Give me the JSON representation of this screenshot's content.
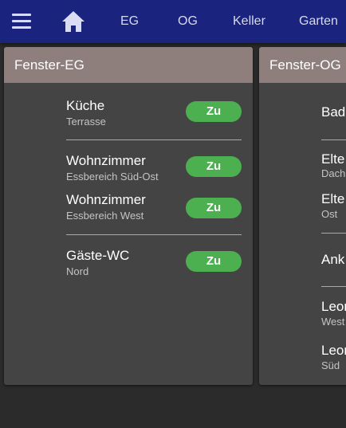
{
  "topbar": {
    "menu_icon": "menu-icon",
    "home_icon": "home-icon",
    "nav": [
      "EG",
      "OG",
      "Keller",
      "Garten"
    ]
  },
  "cards": [
    {
      "title": "Fenster-EG",
      "rows": [
        {
          "title": "Küche",
          "subtitle": "Terrasse",
          "state": "Zu"
        },
        {
          "title": "Wohnzimmer",
          "subtitle": "Essbereich Süd-Ost",
          "state": "Zu"
        },
        {
          "title": "Wohnzimmer",
          "subtitle": "Essbereich West",
          "state": "Zu"
        },
        {
          "title": "Gäste-WC",
          "subtitle": "Nord",
          "state": "Zu"
        }
      ]
    },
    {
      "title": "Fenster-OG",
      "rows": [
        {
          "title": "Bad",
          "subtitle": ""
        },
        {
          "title": "Elte",
          "subtitle": "Dach"
        },
        {
          "title": "Elte",
          "subtitle": "Ost"
        },
        {
          "title": "Ank",
          "subtitle": ""
        },
        {
          "title": "Leon",
          "subtitle": "West"
        },
        {
          "title": "Leon",
          "subtitle": "Süd"
        }
      ]
    }
  ],
  "colors": {
    "topbar": "#1a237e",
    "card_header": "#8e7f7d",
    "card_body": "#444444",
    "button": "#4caf50",
    "background": "#2b2b2b"
  }
}
